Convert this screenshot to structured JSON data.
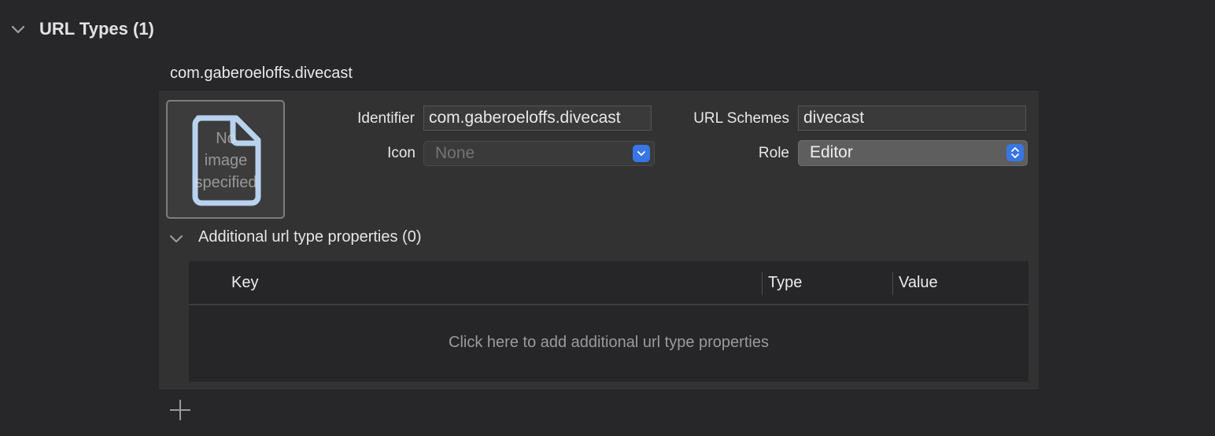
{
  "section": {
    "title": "URL Types (1)"
  },
  "url_type": {
    "name": "com.gaberoeloffs.divecast",
    "image_placeholder": [
      "No",
      "image",
      "specified"
    ],
    "identifier_label": "Identifier",
    "identifier_value": "com.gaberoeloffs.divecast",
    "icon_label": "Icon",
    "icon_value": "None",
    "url_schemes_label": "URL Schemes",
    "url_schemes_value": "divecast",
    "role_label": "Role",
    "role_value": "Editor"
  },
  "additional": {
    "title": "Additional url type properties (0)",
    "columns": [
      "Key",
      "Type",
      "Value"
    ],
    "placeholder": "Click here to add additional url type properties"
  },
  "colors": {
    "background": "#27272a",
    "panel": "#323232",
    "accent": "#3876e6"
  },
  "icons": {
    "section_toggle": "chevron-down-icon",
    "subsection_toggle": "chevron-down-icon",
    "image_placeholder": "document-icon",
    "popup_arrow": "chevron-down-icon",
    "role_arrow": "chevron-up-down-icon",
    "add": "plus-icon"
  }
}
